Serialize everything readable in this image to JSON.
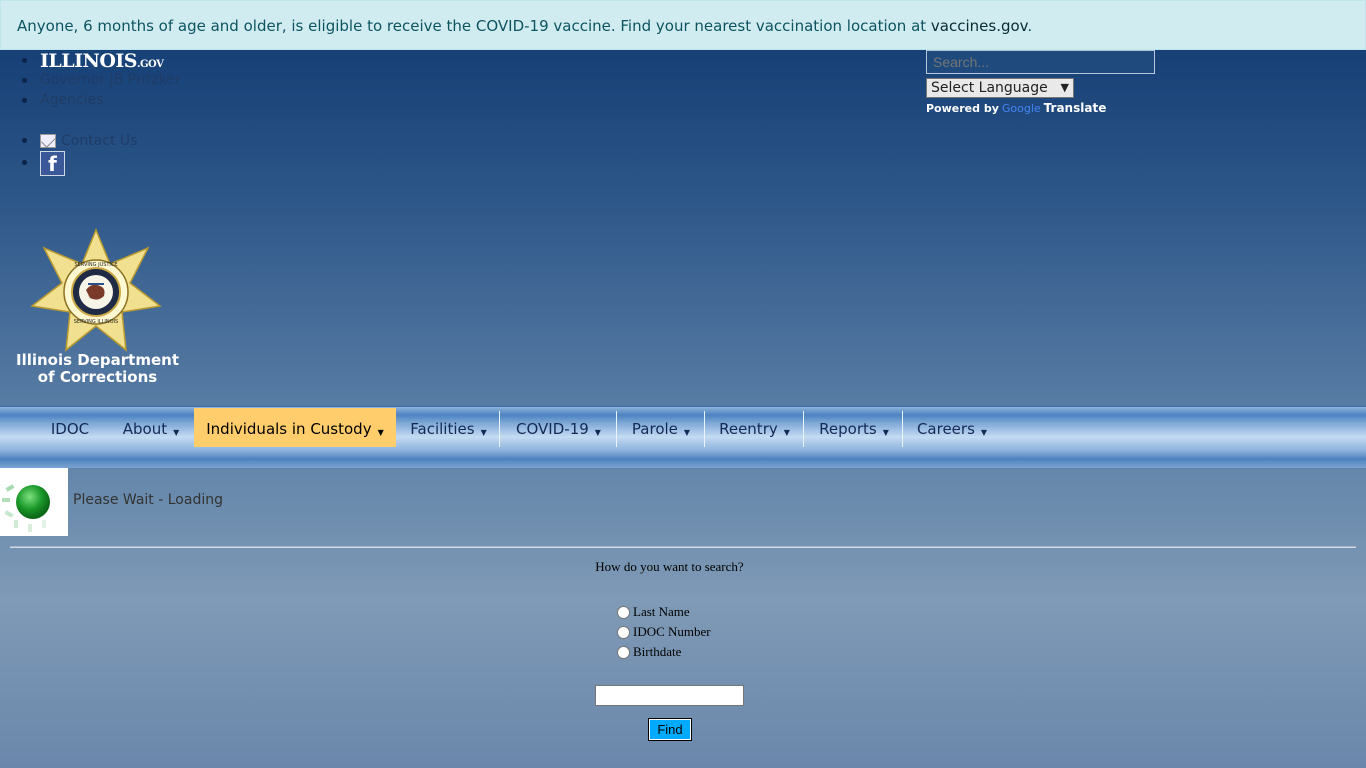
{
  "alert": {
    "text": "Anyone, 6 months of age and older, is eligible to receive the COVID-19 vaccine. Find your nearest vaccination location at ",
    "link": "vaccines.gov",
    "suffix": "."
  },
  "header": {
    "gov_logo": "ILLINOIS",
    "gov_logo_suffix": ".GOV",
    "governor_link": "Governor JB Pritzker",
    "agencies_link": "Agencies",
    "contact_link": "Contact Us",
    "search_placeholder": "Search...",
    "language_select": "Select Language",
    "powered_by": "Powered by",
    "google": "Google",
    "translate": "Translate"
  },
  "branding": {
    "dept_name_line1": "Illinois Department",
    "dept_name_line2": "of Corrections",
    "seal_top_text": "SERVING JUSTICE",
    "seal_bottom_text": "SERVING ILLINOIS"
  },
  "nav": {
    "items": [
      {
        "label": "IDOC",
        "dropdown": false
      },
      {
        "label": "About",
        "dropdown": true
      },
      {
        "label": "Individuals in Custody",
        "dropdown": true,
        "active": true
      },
      {
        "label": "Facilities",
        "dropdown": true
      },
      {
        "label": "COVID-19",
        "dropdown": true
      },
      {
        "label": "Parole",
        "dropdown": true
      },
      {
        "label": "Reentry",
        "dropdown": true
      },
      {
        "label": "Reports",
        "dropdown": true
      },
      {
        "label": "Careers",
        "dropdown": true
      }
    ]
  },
  "loading": {
    "text": "Please Wait - Loading"
  },
  "search_form": {
    "question": "How do you want to search?",
    "options": [
      "Last Name",
      "IDOC Number",
      "Birthdate"
    ],
    "input_value": "",
    "find_label": "Find"
  },
  "colors": {
    "alert_bg": "#d1ecf1",
    "alert_text": "#0c5460",
    "nav_active": "#ffcd6b",
    "find_button": "#00aaff"
  }
}
